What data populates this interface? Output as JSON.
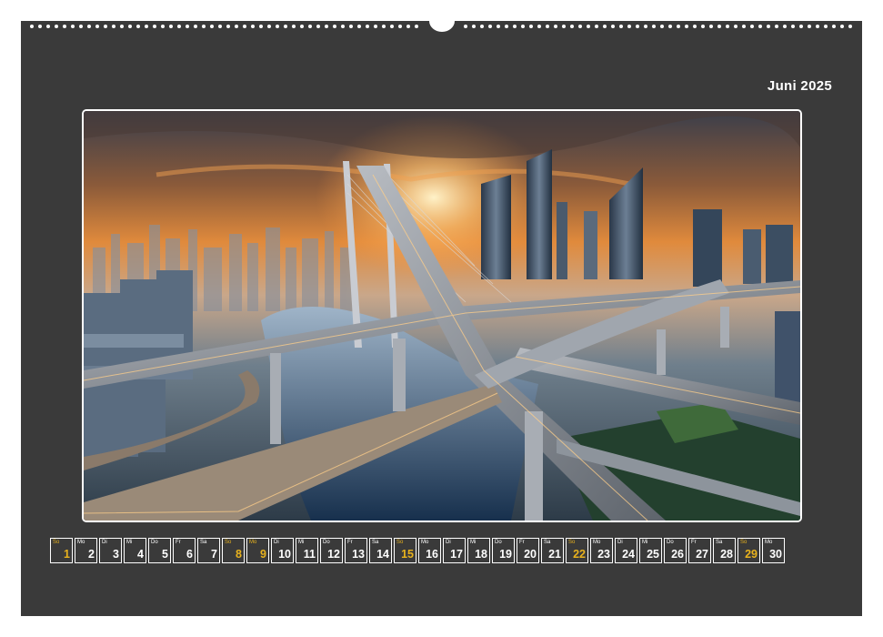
{
  "calendar": {
    "month_title": "Juni 2025",
    "highlight_color": "#e8b21d",
    "background_color": "#3a3a3a",
    "photo": {
      "subject": "futuristic highway interchange over river at sunset with skyscrapers",
      "icon": "city-photo"
    },
    "days": [
      {
        "weekday": "So",
        "day": "1",
        "highlight": true
      },
      {
        "weekday": "Mo",
        "day": "2",
        "highlight": false
      },
      {
        "weekday": "Di",
        "day": "3",
        "highlight": false
      },
      {
        "weekday": "Mi",
        "day": "4",
        "highlight": false
      },
      {
        "weekday": "Do",
        "day": "5",
        "highlight": false
      },
      {
        "weekday": "Fr",
        "day": "6",
        "highlight": false
      },
      {
        "weekday": "Sa",
        "day": "7",
        "highlight": false
      },
      {
        "weekday": "So",
        "day": "8",
        "highlight": true
      },
      {
        "weekday": "Mo",
        "day": "9",
        "highlight": true
      },
      {
        "weekday": "Di",
        "day": "10",
        "highlight": false
      },
      {
        "weekday": "Mi",
        "day": "11",
        "highlight": false
      },
      {
        "weekday": "Do",
        "day": "12",
        "highlight": false
      },
      {
        "weekday": "Fr",
        "day": "13",
        "highlight": false
      },
      {
        "weekday": "Sa",
        "day": "14",
        "highlight": false
      },
      {
        "weekday": "So",
        "day": "15",
        "highlight": true
      },
      {
        "weekday": "Mo",
        "day": "16",
        "highlight": false
      },
      {
        "weekday": "Di",
        "day": "17",
        "highlight": false
      },
      {
        "weekday": "Mi",
        "day": "18",
        "highlight": false
      },
      {
        "weekday": "Do",
        "day": "19",
        "highlight": false
      },
      {
        "weekday": "Fr",
        "day": "20",
        "highlight": false
      },
      {
        "weekday": "Sa",
        "day": "21",
        "highlight": false
      },
      {
        "weekday": "So",
        "day": "22",
        "highlight": true
      },
      {
        "weekday": "Mo",
        "day": "23",
        "highlight": false
      },
      {
        "weekday": "Di",
        "day": "24",
        "highlight": false
      },
      {
        "weekday": "Mi",
        "day": "25",
        "highlight": false
      },
      {
        "weekday": "Do",
        "day": "26",
        "highlight": false
      },
      {
        "weekday": "Fr",
        "day": "27",
        "highlight": false
      },
      {
        "weekday": "Sa",
        "day": "28",
        "highlight": false
      },
      {
        "weekday": "So",
        "day": "29",
        "highlight": true
      },
      {
        "weekday": "Mo",
        "day": "30",
        "highlight": false
      }
    ]
  }
}
